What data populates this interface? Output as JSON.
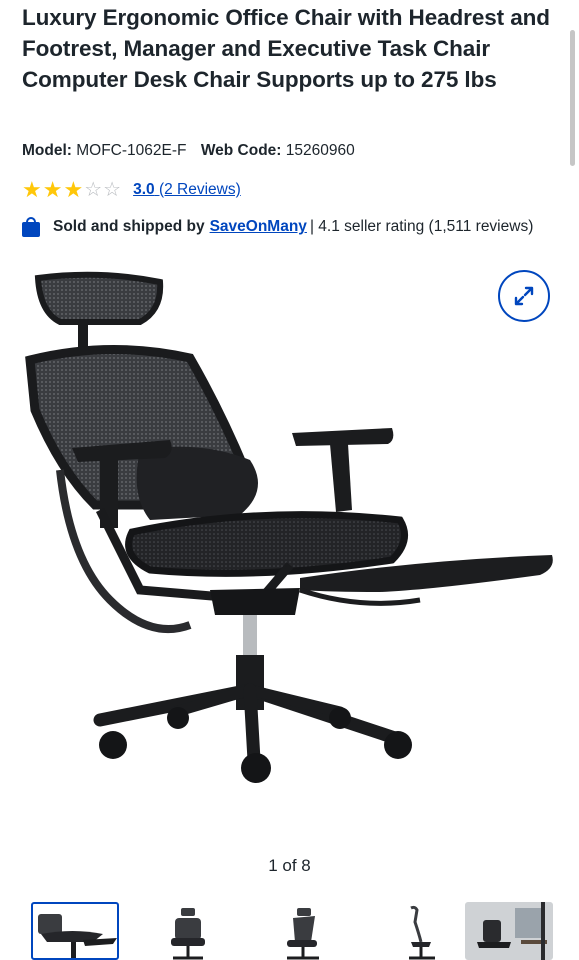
{
  "product": {
    "title": "Luxury Ergonomic Office Chair with Headrest and Footrest, Manager and Executive Task Chair Computer Desk Chair Supports up to 275 lbs",
    "model_label": "Model:",
    "model_value": "MOFC-1062E-F",
    "webcode_label": "Web Code:",
    "webcode_value": "15260960"
  },
  "rating": {
    "stars_filled": 3,
    "stars_total": 5,
    "value": "3.0",
    "reviews": "(2 Reviews)",
    "star_color": "#ffc709"
  },
  "seller": {
    "prefix": "Sold and shipped by",
    "name": "SaveOnMany",
    "rating_text": "| 4.1 seller rating (1,511 reviews)"
  },
  "gallery": {
    "counter": "1 of 8",
    "expand_icon": "expand-arrows-icon",
    "thumbnails": [
      "chair-reclined-footrest",
      "chair-front",
      "chair-three-quarter",
      "chair-side",
      "chair-in-room"
    ]
  },
  "colors": {
    "link": "#0046be",
    "text": "#1d252c"
  }
}
